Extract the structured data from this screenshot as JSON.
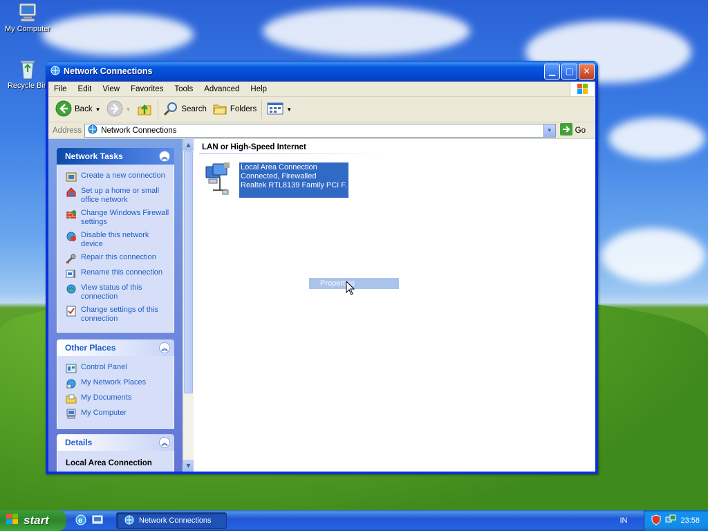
{
  "desktop": {
    "icons": [
      {
        "label": "My Computer"
      },
      {
        "label": "Recycle Bin"
      }
    ]
  },
  "window": {
    "title": "Network Connections",
    "menu": [
      "File",
      "Edit",
      "View",
      "Favorites",
      "Tools",
      "Advanced",
      "Help"
    ],
    "toolbar": {
      "back": "Back",
      "search": "Search",
      "folders": "Folders"
    },
    "address": {
      "label": "Address",
      "value": "Network Connections",
      "go": "Go"
    }
  },
  "network_tasks": {
    "title": "Network Tasks",
    "items": [
      {
        "label": "Create a new connection",
        "icon": "new-connection-icon"
      },
      {
        "label": "Set up a home or small office network",
        "icon": "home-network-icon"
      },
      {
        "label": "Change Windows Firewall settings",
        "icon": "firewall-icon"
      },
      {
        "label": "Disable this network device",
        "icon": "disable-device-icon"
      },
      {
        "label": "Repair this connection",
        "icon": "repair-icon"
      },
      {
        "label": "Rename this connection",
        "icon": "rename-icon"
      },
      {
        "label": "View status of this connection",
        "icon": "status-icon"
      },
      {
        "label": "Change settings of this connection",
        "icon": "settings-icon"
      }
    ]
  },
  "other_places": {
    "title": "Other Places",
    "items": [
      {
        "label": "Control Panel",
        "icon": "control-panel-icon"
      },
      {
        "label": "My Network Places",
        "icon": "network-places-icon"
      },
      {
        "label": "My Documents",
        "icon": "documents-icon"
      },
      {
        "label": "My Computer",
        "icon": "computer-icon"
      }
    ]
  },
  "details": {
    "title": "Details",
    "name": "Local Area Connection"
  },
  "content": {
    "group": "LAN or High-Speed Internet",
    "connection": {
      "name": "Local Area Connection",
      "status": "Connected, Firewalled",
      "device": "Realtek RTL8139 Family PCI F..."
    },
    "context_item": "Properties"
  },
  "taskbar": {
    "start": "start",
    "task": "Network Connections",
    "language": "IN",
    "clock": "23:58"
  },
  "colors": {
    "selection": "#316ac5",
    "task_link": "#215dc6",
    "titlebar": "#0543c8"
  }
}
